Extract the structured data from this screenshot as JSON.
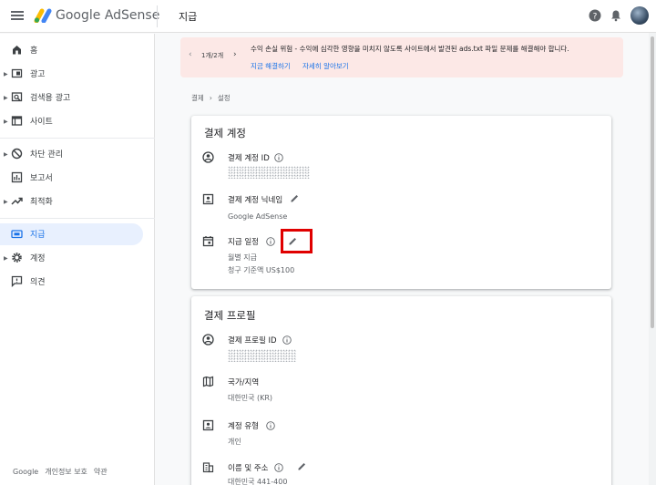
{
  "app": {
    "logo_text": "Google AdSense",
    "page_title": "지급"
  },
  "sidebar": {
    "items": [
      {
        "label": "홈",
        "icon": "home-icon"
      },
      {
        "label": "광고",
        "icon": "ads-icon"
      },
      {
        "label": "검색용 광고",
        "icon": "search-ads-icon"
      },
      {
        "label": "사이트",
        "icon": "sites-icon"
      },
      {
        "label": "차단 관리",
        "icon": "block-icon"
      },
      {
        "label": "보고서",
        "icon": "reports-icon"
      },
      {
        "label": "최적화",
        "icon": "optimization-icon"
      },
      {
        "label": "지급",
        "icon": "payments-icon",
        "active": true
      },
      {
        "label": "계정",
        "icon": "account-gear-icon"
      },
      {
        "label": "의견",
        "icon": "feedback-icon"
      }
    ],
    "footer": [
      "Google",
      "개인정보 보호",
      "약관"
    ]
  },
  "banner": {
    "pager": "1개/2개",
    "message": "수익 손실 위험 - 수익에 심각한 영향을 미치지 않도록 사이트에서 발견된 ads.txt 파일 문제를 해결해야 합니다.",
    "action_fix": "지금 해결하기",
    "action_learn": "자세히 알아보기"
  },
  "breadcrumb": {
    "root": "결제",
    "current": "설정"
  },
  "payment_account": {
    "title": "결제 계정",
    "account_id_label": "결제 계정 ID",
    "nickname_label": "결제 계정 닉네임",
    "nickname_value": "Google AdSense",
    "schedule_label": "지급 일정",
    "schedule_value": "월별 지급",
    "threshold_value": "청구 기준액 US$100"
  },
  "payment_profile": {
    "title": "결제 프로필",
    "profile_id_label": "결제 프로필 ID",
    "country_label": "국가/지역",
    "country_value": "대한민국 (KR)",
    "account_type_label": "계정 유형",
    "account_type_value": "개인",
    "name_address_label": "이름 및 주소",
    "name_address_value": "대한민국 441-400"
  },
  "colors": {
    "accent": "#1a73e8",
    "banner_bg": "#fce8e6",
    "highlight": "#e00000"
  }
}
